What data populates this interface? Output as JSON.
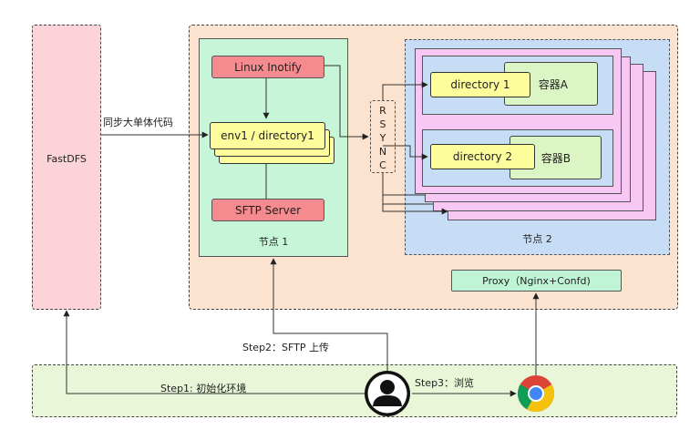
{
  "fastdfs": {
    "label": "FastDFS"
  },
  "node1": {
    "label": "节点 1",
    "inotify": "Linux Inotify",
    "env": "env1 / directory1",
    "sftp": "SFTP Server"
  },
  "rsync": {
    "letters": [
      "R",
      "S",
      "Y",
      "N",
      "C"
    ]
  },
  "node2": {
    "label": "节点 2",
    "containers": [
      {
        "dir": "directory 1",
        "name": "容器A"
      },
      {
        "dir": "directory 2",
        "name": "容器B"
      }
    ],
    "proxy": "Proxy（Nginx+Confd)"
  },
  "arrows": {
    "sync_code": "同步大单体代码",
    "step1": "Step1: 初始化环境",
    "step2": "Step2：SFTP 上传",
    "step3": "Step3：浏览"
  },
  "icons": {
    "user": "user-silhouette-icon",
    "browser": "chrome-browser-icon"
  },
  "colors": {
    "pink_fill": "#fbd3d8",
    "node_area": "#fce3d0",
    "green_fill": "#c7f5d8",
    "blue_fill": "#c7ddf6",
    "magenta_fill": "#f7c8f4",
    "red_box": "#f58a8f",
    "yellow_box": "#fdfd9c",
    "light_green_box": "#dcf5c4",
    "bottom_bar": "#e9f6d8"
  }
}
